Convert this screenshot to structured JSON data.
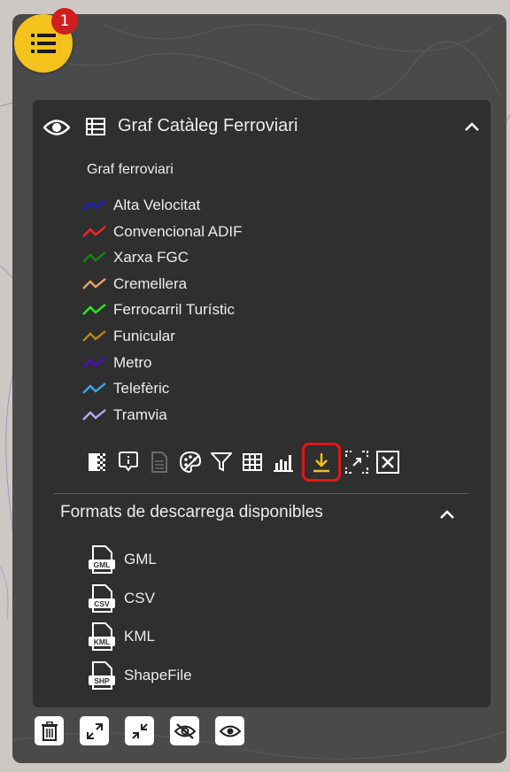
{
  "toggle": {
    "badge_count": "1",
    "icon": "list-icon"
  },
  "layer": {
    "title": "Graf Catàleg Ferroviari",
    "group_title": "Graf ferroviari",
    "legend": [
      {
        "label": "Alta Velocitat",
        "color": "#1c1ccc"
      },
      {
        "label": "Convencional ADIF",
        "color": "#ff2222"
      },
      {
        "label": "Xarxa FGC",
        "color": "#118811"
      },
      {
        "label": "Cremellera",
        "color": "#f0a070"
      },
      {
        "label": "Ferrocarril Turístic",
        "color": "#22ee22"
      },
      {
        "label": "Funicular",
        "color": "#b8861c"
      },
      {
        "label": "Metro",
        "color": "#4a10c0"
      },
      {
        "label": "Telefèric",
        "color": "#33aaee"
      },
      {
        "label": "Tramvia",
        "color": "#b8a8f8"
      }
    ],
    "tools": [
      "opacity-icon",
      "info-icon",
      "document-icon",
      "palette-icon",
      "filter-icon",
      "table-icon",
      "chart-icon",
      "download-icon",
      "zoom-extent-icon",
      "close-icon"
    ]
  },
  "downloads": {
    "title": "Formats de descarrega disponibles",
    "formats": [
      {
        "label": "GML",
        "icon_text": "GML"
      },
      {
        "label": "CSV",
        "icon_text": "CSV"
      },
      {
        "label": "KML",
        "icon_text": "KML"
      },
      {
        "label": "ShapeFile",
        "icon_text": "SHP"
      }
    ]
  },
  "bottom": [
    "trash-icon",
    "expand-icon",
    "collapse-icon",
    "eye-off-icon",
    "eye-icon"
  ],
  "colors": {
    "accent": "#f4c21c",
    "badge": "#d01f1f",
    "highlight": "#e01818",
    "panel": "#2f2f2f"
  }
}
